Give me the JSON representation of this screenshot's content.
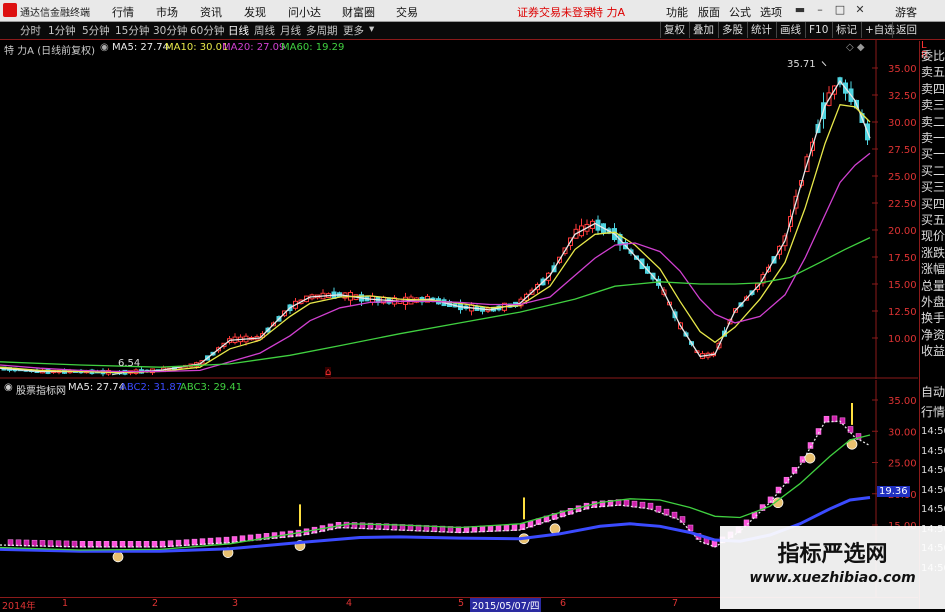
{
  "menubar": {
    "app_title": "通达信金融终端",
    "menus": [
      "行情",
      "市场",
      "资讯",
      "发现",
      "问小达",
      "财富圈",
      "交易"
    ],
    "warning": "证券交易未登录",
    "stock": "特 力A",
    "right_menus": [
      "功能",
      "版面",
      "公式",
      "选项"
    ],
    "guest": "游客"
  },
  "periodbar": {
    "periods": [
      "分时",
      "1分钟",
      "5分钟",
      "15分钟",
      "30分钟",
      "60分钟",
      "日线",
      "周线",
      "月线",
      "多周期",
      "更多"
    ],
    "selected": "日线",
    "tools": [
      "复权",
      "叠加",
      "多股",
      "统计",
      "画线",
      "F10",
      "标记",
      "+自选",
      "返回"
    ]
  },
  "main_chart": {
    "title": "特 力A (日线前复权)",
    "ma": [
      {
        "name": "MA5",
        "value": "27.74",
        "color": "#e8e8e8"
      },
      {
        "name": "MA10",
        "value": "30.01",
        "color": "#e8e84a"
      },
      {
        "name": "MA20",
        "value": "27.09",
        "color": "#d040d0"
      },
      {
        "name": "MA60",
        "value": "19.29",
        "color": "#40d040"
      }
    ],
    "y_ticks": [
      "35.00",
      "32.50",
      "30.00",
      "27.50",
      "25.00",
      "22.50",
      "20.00",
      "17.50",
      "15.00",
      "12.50",
      "10.00"
    ],
    "high_label": "35.71",
    "low_label": "6.54"
  },
  "sub_chart": {
    "title": "股票指标网",
    "items": [
      {
        "name": "MA5",
        "value": "27.74",
        "color": "#e8e8e8"
      },
      {
        "name": "ABC2",
        "value": "31.87",
        "color": "#3b4bff"
      },
      {
        "name": "ABC3",
        "value": "29.41",
        "color": "#40d040"
      }
    ],
    "y_ticks": [
      "35.00",
      "30.00",
      "25.00",
      "20.00",
      "15.00"
    ],
    "current_value": "19.36"
  },
  "right_panel": {
    "top_letters": [
      "L",
      "R"
    ],
    "items": [
      "委比",
      "卖五",
      "卖四",
      "卖三",
      "卖二",
      "卖一",
      "买一",
      "买二",
      "买三",
      "买四",
      "买五",
      "现价",
      "涨跌",
      "涨幅",
      "总量",
      "外盘",
      "换手",
      "净资",
      "收益"
    ],
    "sub_items": [
      "自动",
      "行情",
      "14:50",
      "14:50",
      "14:50",
      "14:50",
      "14:50",
      "14:50",
      "14:50",
      "14:50"
    ]
  },
  "bottom_axis": {
    "labels": [
      "2014年",
      "1",
      "2",
      "3",
      "4",
      "5",
      "6",
      "7"
    ],
    "cursor_date": "2015/05/07/四"
  },
  "watermark": {
    "title": "指标严选网",
    "url": "www.xuezhibiao.com"
  },
  "chart_data": [
    {
      "type": "candlestick",
      "title": "特 力A (日线前复权)",
      "x_period": "2014-12 to 2015-09 (daily)",
      "ylim": [
        6,
        36
      ],
      "y_ticks": [
        10,
        12.5,
        15,
        17.5,
        20,
        22.5,
        25,
        27.5,
        30,
        32.5,
        35
      ],
      "series": [
        {
          "name": "MA5",
          "color": "#e8e8e8",
          "points": [
            [
              0,
              7.2
            ],
            [
              40,
              6.9
            ],
            [
              80,
              6.9
            ],
            [
              120,
              6.8
            ],
            [
              160,
              7.0
            ],
            [
              200,
              7.6
            ],
            [
              230,
              9.8
            ],
            [
              260,
              10.0
            ],
            [
              290,
              12.8
            ],
            [
              310,
              13.8
            ],
            [
              340,
              14.0
            ],
            [
              370,
              13.6
            ],
            [
              400,
              13.4
            ],
            [
              430,
              13.6
            ],
            [
              460,
              12.9
            ],
            [
              490,
              12.6
            ],
            [
              520,
              13.2
            ],
            [
              550,
              15.8
            ],
            [
              575,
              19.6
            ],
            [
              595,
              20.6
            ],
            [
              615,
              19.6
            ],
            [
              635,
              17.6
            ],
            [
              660,
              15.0
            ],
            [
              680,
              11.2
            ],
            [
              700,
              8.3
            ],
            [
              715,
              8.5
            ],
            [
              735,
              12.5
            ],
            [
              760,
              15.0
            ],
            [
              785,
              19.0
            ],
            [
              805,
              25.5
            ],
            [
              825,
              31.5
            ],
            [
              840,
              33.8
            ],
            [
              855,
              32.0
            ],
            [
              870,
              28.5
            ]
          ]
        },
        {
          "name": "MA10",
          "color": "#e8e84a",
          "points": [
            [
              0,
              7.3
            ],
            [
              40,
              7.0
            ],
            [
              80,
              6.9
            ],
            [
              120,
              6.8
            ],
            [
              160,
              6.9
            ],
            [
              200,
              7.3
            ],
            [
              230,
              9.0
            ],
            [
              260,
              9.8
            ],
            [
              290,
              12.0
            ],
            [
              310,
              13.2
            ],
            [
              340,
              13.8
            ],
            [
              370,
              13.9
            ],
            [
              400,
              13.6
            ],
            [
              430,
              13.5
            ],
            [
              460,
              13.2
            ],
            [
              490,
              12.8
            ],
            [
              520,
              13.0
            ],
            [
              550,
              14.8
            ],
            [
              575,
              18.2
            ],
            [
              595,
              19.6
            ],
            [
              615,
              19.8
            ],
            [
              635,
              18.6
            ],
            [
              660,
              16.4
            ],
            [
              680,
              13.4
            ],
            [
              700,
              10.6
            ],
            [
              715,
              9.6
            ],
            [
              735,
              11.0
            ],
            [
              760,
              13.6
            ],
            [
              785,
              17.0
            ],
            [
              805,
              22.0
            ],
            [
              825,
              28.0
            ],
            [
              840,
              31.6
            ],
            [
              855,
              31.4
            ],
            [
              870,
              30.0
            ]
          ]
        },
        {
          "name": "MA20",
          "color": "#d040d0",
          "points": [
            [
              0,
              7.5
            ],
            [
              40,
              7.2
            ],
            [
              80,
              7.0
            ],
            [
              120,
              6.9
            ],
            [
              160,
              6.9
            ],
            [
              200,
              7.0
            ],
            [
              230,
              7.8
            ],
            [
              260,
              8.6
            ],
            [
              290,
              10.2
            ],
            [
              310,
              11.6
            ],
            [
              340,
              12.8
            ],
            [
              370,
              13.3
            ],
            [
              400,
              13.4
            ],
            [
              430,
              13.4
            ],
            [
              460,
              13.3
            ],
            [
              490,
              13.1
            ],
            [
              520,
              13.1
            ],
            [
              550,
              13.8
            ],
            [
              575,
              15.8
            ],
            [
              595,
              17.4
            ],
            [
              615,
              18.6
            ],
            [
              635,
              18.8
            ],
            [
              660,
              18.0
            ],
            [
              680,
              16.2
            ],
            [
              700,
              13.6
            ],
            [
              715,
              12.2
            ],
            [
              735,
              11.4
            ],
            [
              760,
              12.0
            ],
            [
              785,
              14.0
            ],
            [
              805,
              17.4
            ],
            [
              825,
              21.4
            ],
            [
              840,
              24.4
            ],
            [
              855,
              26.0
            ],
            [
              870,
              27.1
            ]
          ]
        },
        {
          "name": "MA60",
          "color": "#40d040",
          "points": [
            [
              0,
              7.8
            ],
            [
              80,
              7.5
            ],
            [
              160,
              7.3
            ],
            [
              230,
              7.6
            ],
            [
              290,
              8.4
            ],
            [
              340,
              9.3
            ],
            [
              400,
              10.4
            ],
            [
              460,
              11.4
            ],
            [
              520,
              12.4
            ],
            [
              575,
              13.6
            ],
            [
              615,
              14.8
            ],
            [
              660,
              15.2
            ],
            [
              700,
              15.0
            ],
            [
              735,
              15.0
            ],
            [
              760,
              15.1
            ],
            [
              790,
              15.6
            ],
            [
              820,
              17.0
            ],
            [
              845,
              18.2
            ],
            [
              870,
              19.3
            ]
          ]
        }
      ]
    },
    {
      "type": "line",
      "title": "股票指标网",
      "ylim": [
        10,
        36
      ],
      "y_ticks": [
        15,
        20,
        25,
        30,
        35
      ],
      "series": [
        {
          "name": "MA5",
          "color": "#e8e8e8",
          "points": [
            [
              0,
              11.8
            ],
            [
              80,
              11.5
            ],
            [
              160,
              11.5
            ],
            [
              230,
              12.2
            ],
            [
              300,
              13.3
            ],
            [
              340,
              14.6
            ],
            [
              400,
              14.2
            ],
            [
              460,
              13.8
            ],
            [
              520,
              14.2
            ],
            [
              555,
              16.0
            ],
            [
              590,
              17.8
            ],
            [
              620,
              18.2
            ],
            [
              650,
              17.6
            ],
            [
              680,
              15.8
            ],
            [
              700,
              12.4
            ],
            [
              715,
              11.5
            ],
            [
              740,
              14.0
            ],
            [
              770,
              18.6
            ],
            [
              800,
              24.5
            ],
            [
              825,
              31.5
            ],
            [
              840,
              31.6
            ],
            [
              855,
              29.0
            ],
            [
              870,
              27.7
            ]
          ]
        },
        {
          "name": "ABC2",
          "color": "#3b4bff",
          "points": [
            [
              0,
              11.1
            ],
            [
              80,
              10.8
            ],
            [
              160,
              10.8
            ],
            [
              230,
              11.2
            ],
            [
              300,
              12.2
            ],
            [
              360,
              13.0
            ],
            [
              400,
              13.1
            ],
            [
              460,
              12.9
            ],
            [
              520,
              12.8
            ],
            [
              560,
              13.6
            ],
            [
              600,
              14.8
            ],
            [
              630,
              15.2
            ],
            [
              660,
              14.8
            ],
            [
              690,
              13.8
            ],
            [
              715,
              12.6
            ],
            [
              740,
              12.4
            ],
            [
              770,
              13.4
            ],
            [
              800,
              15.2
            ],
            [
              830,
              17.6
            ],
            [
              850,
              19.0
            ],
            [
              870,
              19.4
            ]
          ]
        },
        {
          "name": "ABC3",
          "color": "#40d040",
          "points": [
            [
              0,
              11.4
            ],
            [
              80,
              11.0
            ],
            [
              160,
              11.1
            ],
            [
              230,
              12.0
            ],
            [
              300,
              13.8
            ],
            [
              350,
              15.2
            ],
            [
              400,
              15.0
            ],
            [
              460,
              14.6
            ],
            [
              520,
              15.2
            ],
            [
              560,
              17.0
            ],
            [
              600,
              18.6
            ],
            [
              630,
              19.2
            ],
            [
              660,
              19.0
            ],
            [
              690,
              17.8
            ],
            [
              715,
              16.4
            ],
            [
              740,
              16.2
            ],
            [
              770,
              18.0
            ],
            [
              800,
              21.6
            ],
            [
              830,
              26.0
            ],
            [
              850,
              28.6
            ],
            [
              870,
              29.4
            ]
          ]
        }
      ]
    }
  ]
}
